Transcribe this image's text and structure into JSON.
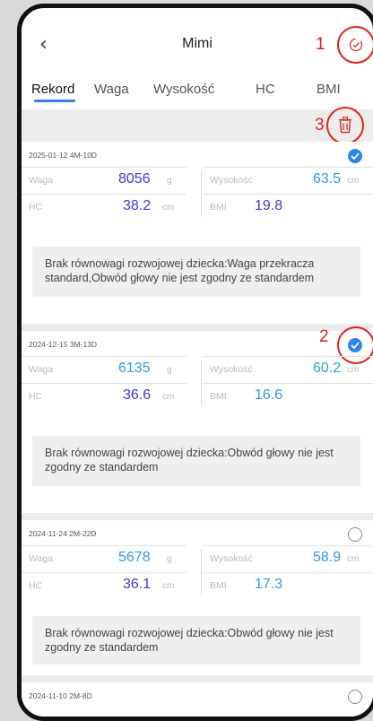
{
  "header": {
    "back_icon": "chevron-left-icon",
    "title": "Mimi"
  },
  "annotations": {
    "one": "1",
    "two": "2",
    "three": "3"
  },
  "tabs": [
    "Rekord",
    "Waga",
    "Wysokość",
    "HC",
    "BMI"
  ],
  "colors": {
    "accent": "#2f7fe6",
    "annotation": "#e0231a",
    "delete": "#e0231a",
    "value_blue": "#3b3bd6",
    "value_teal": "#2f9ae8"
  },
  "records": [
    {
      "date": "2025-01-12 4M-10D",
      "checked": true,
      "waga_label": "Waga",
      "waga": "8056",
      "waga_unit": "g",
      "wys_label": "Wysokość",
      "wys": "63.5",
      "wys_unit": "cm",
      "hc_label": "HC",
      "hc": "38.2",
      "hc_unit": "cm",
      "bmi_label": "BMI",
      "bmi": "19.8",
      "note": "Brak równowagi rozwojowej dziecka:Waga przekracza standard,Obwód głowy nie jest zgodny ze standardem"
    },
    {
      "date": "2024-12-15 3M-13D",
      "checked": true,
      "waga_label": "Waga",
      "waga": "6135",
      "waga_unit": "g",
      "wys_label": "Wysokość",
      "wys": "60.2",
      "wys_unit": "cm",
      "hc_label": "HC",
      "hc": "36.6",
      "hc_unit": "cm",
      "bmi_label": "BMI",
      "bmi": "16.6",
      "note": "Brak równowagi rozwojowej dziecka:Obwód głowy nie jest zgodny ze standardem"
    },
    {
      "date": "2024-11-24 2M-22D",
      "checked": false,
      "waga_label": "Waga",
      "waga": "5678",
      "waga_unit": "g",
      "wys_label": "Wysokość",
      "wys": "58.9",
      "wys_unit": "cm",
      "hc_label": "HC",
      "hc": "36.1",
      "hc_unit": "cm",
      "bmi_label": "BMI",
      "bmi": "17.3",
      "note": "Brak równowagi rozwojowej dziecka:Obwód głowy nie jest zgodny ze standardem"
    },
    {
      "date": "2024-11-10 2M-8D",
      "checked": false
    }
  ]
}
